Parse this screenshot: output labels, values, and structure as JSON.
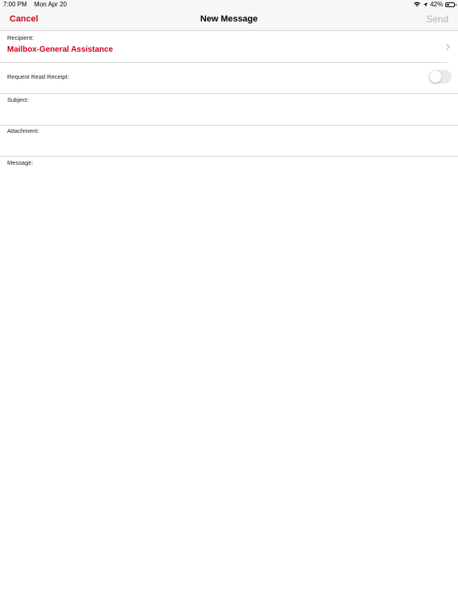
{
  "status_bar": {
    "time": "7:00 PM",
    "date": "Mon Apr 20",
    "battery_percent": "42%",
    "battery_level": 0.42
  },
  "nav": {
    "cancel_label": "Cancel",
    "title": "New Message",
    "send_label": "Send"
  },
  "form": {
    "recipient_label": "Recipient:",
    "recipient_value": "Mailbox-General Assistance",
    "read_receipt_label": "Request Read Receipt:",
    "read_receipt_on": false,
    "subject_label": "Subject:",
    "subject_value": "",
    "attachment_label": "Attachment:",
    "message_label": "Message:",
    "message_value": ""
  },
  "colors": {
    "accent": "#d0021b",
    "disabled": "#b3b3b3",
    "toggle_off": "#e9e9ea"
  }
}
